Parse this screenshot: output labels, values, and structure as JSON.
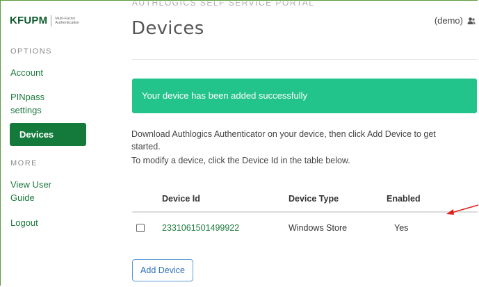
{
  "logo": {
    "main": "KFUPM",
    "sub_line1": "Multi-Factor",
    "sub_line2": "Authentication"
  },
  "sidebar": {
    "options_label": "OPTIONS",
    "items": [
      {
        "label": "Account"
      },
      {
        "label_line1": "PINpass",
        "label_line2": "settings"
      },
      {
        "label": "Devices",
        "active": true
      }
    ],
    "more_label": "MORE",
    "more_items": [
      {
        "label_line1": "View User",
        "label_line2": "Guide"
      },
      {
        "label": "Logout"
      }
    ]
  },
  "header": {
    "portal_title": "AUTHLOGICS SELF SERVICE PORTAL",
    "page_title": "Devices",
    "user": "(demo)",
    "user_icon": "users-icon"
  },
  "alert": {
    "text": "Your device has been added successfully",
    "color": "#23c38c"
  },
  "description": {
    "line1": "Download Authlogics Authenticator on your device, then click Add Device to get",
    "line2": "started.",
    "line3": "To modify a device, click the Device Id in the table below."
  },
  "table": {
    "columns": [
      "Device Id",
      "Device Type",
      "Enabled"
    ],
    "rows": [
      {
        "checked": false,
        "device_id": "2331061501499922",
        "device_type": "Windows Store",
        "enabled": "Yes"
      }
    ]
  },
  "buttons": {
    "add_device": "Add Device"
  },
  "annotation": {
    "icon": "red-arrow-icon",
    "color": "#e0201c"
  },
  "colors": {
    "brand_green": "#137a3c",
    "link_green": "#1e7a3e",
    "button_blue": "#2a6ebd"
  }
}
